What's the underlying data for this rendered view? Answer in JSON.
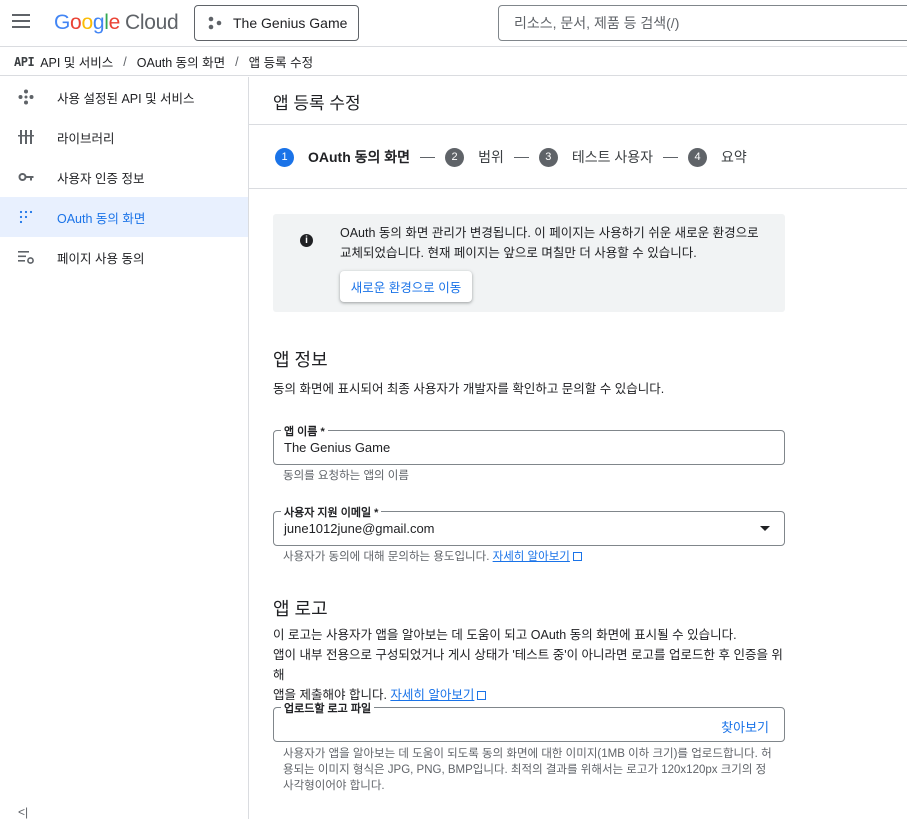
{
  "header": {
    "logo_google": [
      "G",
      "o",
      "o",
      "g",
      "l",
      "e"
    ],
    "logo_cloud": "Cloud",
    "project_name": "The Genius Game",
    "search_placeholder": "리소스, 문서, 제품 등 검색(/)"
  },
  "breadcrumb": {
    "api_logo": "API",
    "items": [
      "API 및 서비스",
      "OAuth 동의 화면",
      "앱 등록 수정"
    ]
  },
  "sidebar": {
    "items": [
      {
        "label": "사용 설정된 API 및 서비스",
        "icon": "api-diamond-icon"
      },
      {
        "label": "라이브러리",
        "icon": "library-icon"
      },
      {
        "label": "사용자 인증 정보",
        "icon": "key-icon"
      },
      {
        "label": "OAuth 동의 화면",
        "icon": "dots-grid-icon",
        "active": true
      },
      {
        "label": "페이지 사용 동의",
        "icon": "settings-list-icon"
      }
    ],
    "collapse_label": "<|"
  },
  "main": {
    "title": "앱 등록 수정",
    "steps": [
      {
        "num": "1",
        "label": "OAuth 동의 화면"
      },
      {
        "num": "2",
        "label": "범위"
      },
      {
        "num": "3",
        "label": "테스트 사용자"
      },
      {
        "num": "4",
        "label": "요약"
      }
    ],
    "notice": {
      "text": "OAuth 동의 화면 관리가 변경됩니다. 이 페이지는 사용하기 쉬운 새로운 환경으로 교체되었습니다. 현재 페이지는 앞으로 며칠만 더 사용할 수 있습니다.",
      "button": "새로운 환경으로 이동"
    },
    "app_info": {
      "heading": "앱 정보",
      "desc": "동의 화면에 표시되어 최종 사용자가 개발자를 확인하고 문의할 수 있습니다.",
      "app_name_label": "앱 이름 *",
      "app_name_value": "The Genius Game",
      "app_name_hint": "동의를 요청하는 앱의 이름",
      "email_label": "사용자 지원 이메일 *",
      "email_value": "june1012june@gmail.com",
      "email_hint": "사용자가 동의에 대해 문의하는 용도입니다.",
      "learn_more": "자세히 알아보기"
    },
    "app_logo": {
      "heading": "앱 로고",
      "desc_line1": "이 로고는 사용자가 앱을 알아보는 데 도움이 되고 OAuth 동의 화면에 표시될 수 있습니다.",
      "desc_line2": "앱이 내부 전용으로 구성되었거나 게시 상태가 '테스트 중'이 아니라면 로고를 업로드한 후 인증을 위해",
      "desc_line3": "앱을 제출해야 합니다.",
      "learn_more": "자세히 알아보기",
      "upload_label": "업로드할 로고 파일",
      "browse": "찾아보기",
      "upload_hint": "사용자가 앱을 알아보는 데 도움이 되도록 동의 화면에 대한 이미지(1MB 이하 크기)를 업로드합니다. 허용되는 이미지 형식은 JPG, PNG, BMP입니다. 최적의 결과를 위해서는 로고가 120x120px 크기의 정사각형이어야 합니다."
    }
  }
}
